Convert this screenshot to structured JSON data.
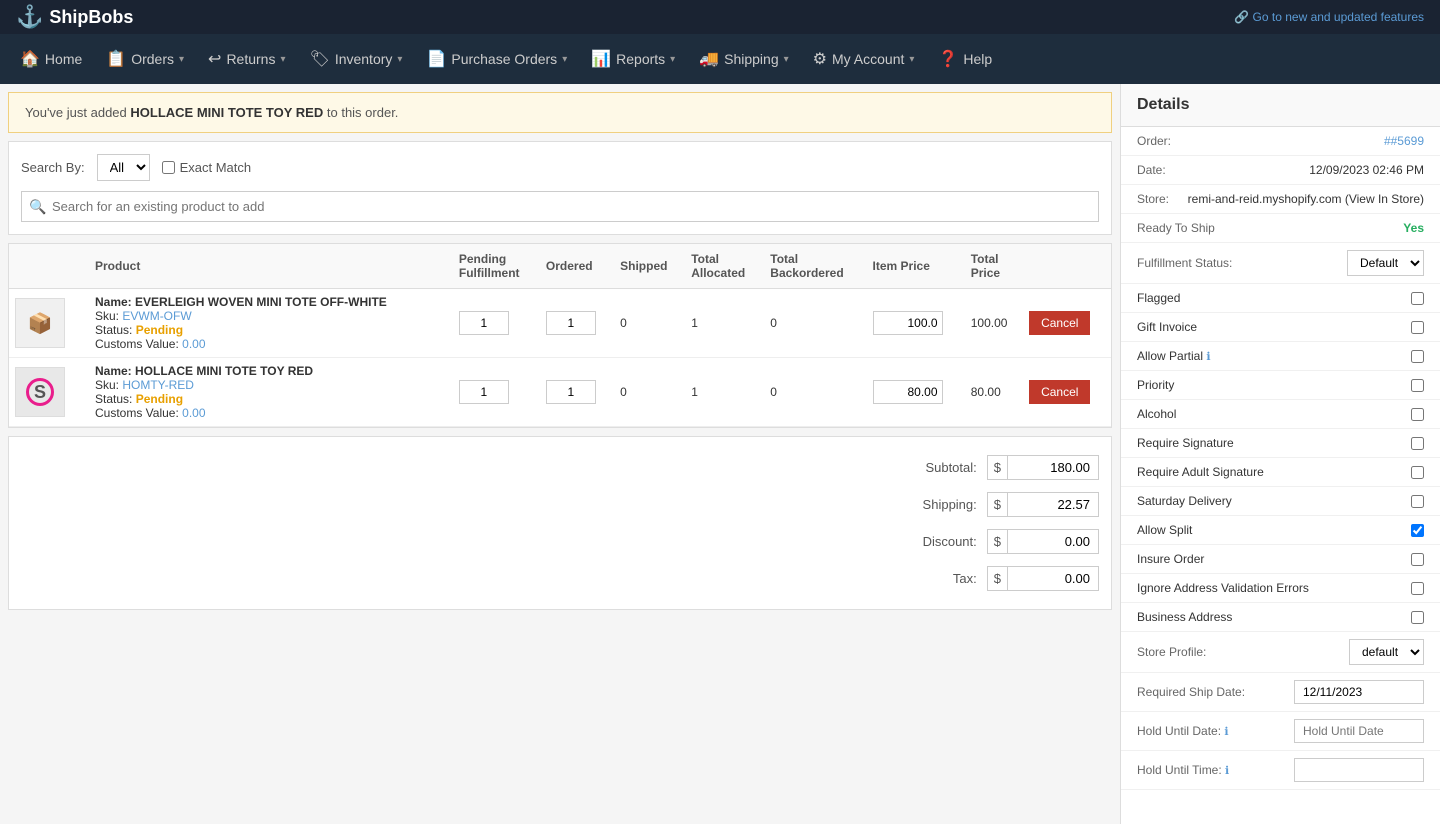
{
  "topBanner": {
    "logoText": "ShipBobs",
    "newFeaturesText": "Go to new and updated features"
  },
  "nav": {
    "items": [
      {
        "label": "Home",
        "icon": "🏠"
      },
      {
        "label": "Orders",
        "icon": "📋",
        "hasDropdown": true
      },
      {
        "label": "Returns",
        "icon": "↩",
        "hasDropdown": true
      },
      {
        "label": "Inventory",
        "icon": "🏷",
        "hasDropdown": true
      },
      {
        "label": "Purchase Orders",
        "icon": "📄",
        "hasDropdown": true
      },
      {
        "label": "Reports",
        "icon": "📊",
        "hasDropdown": true
      },
      {
        "label": "Shipping",
        "icon": "🚚",
        "hasDropdown": true
      },
      {
        "label": "My Account",
        "icon": "⚙",
        "hasDropdown": true
      },
      {
        "label": "Help",
        "icon": "❓"
      }
    ]
  },
  "alert": {
    "prefix": "You've just added",
    "productName": "HOLLACE MINI TOTE TOY RED",
    "suffix": "to this order."
  },
  "searchArea": {
    "searchByLabel": "Search By:",
    "searchByDefault": "All",
    "exactMatchLabel": "Exact Match",
    "searchPlaceholder": "Search for an existing product to add"
  },
  "table": {
    "columns": [
      "Product",
      "Pending Fulfillment",
      "Ordered",
      "Shipped",
      "Total Allocated",
      "Total Backordered",
      "Item Price",
      "Total Price"
    ],
    "rows": [
      {
        "id": "row1",
        "imgIcon": "📦",
        "name": "Name: EVERLEIGH WOVEN MINI TOTE OFF-WHITE",
        "nameLabel": "EVERLEIGH WOVEN MINI TOTE OFF-WHITE",
        "skuLabel": "Sku:",
        "sku": "EVWM-OFW",
        "statusLabel": "Status:",
        "status": "Pending",
        "customsLabel": "Customs Value:",
        "customsValue": "0.00",
        "pendingFulfillment": "1",
        "ordered": "1",
        "shipped": "0",
        "totalAllocated": "1",
        "totalBackordered": "0",
        "itemPrice": "100.0",
        "totalPrice": "100.00",
        "cancelLabel": "Cancel"
      },
      {
        "id": "row2",
        "imgIcon": "S",
        "name": "Name: HOLLACE MINI TOTE TOY RED",
        "nameLabel": "HOLLACE MINI TOTE TOY RED",
        "skuLabel": "Sku:",
        "sku": "HOMTY-RED",
        "statusLabel": "Status:",
        "status": "Pending",
        "customsLabel": "Customs Value:",
        "customsValue": "0.00",
        "pendingFulfillment": "1",
        "ordered": "1",
        "shipped": "0",
        "totalAllocated": "1",
        "totalBackordered": "0",
        "itemPrice": "80.00",
        "totalPrice": "80.00",
        "cancelLabel": "Cancel"
      }
    ]
  },
  "totals": {
    "subtotalLabel": "Subtotal:",
    "subtotalValue": "180.00",
    "shippingLabel": "Shipping:",
    "shippingValue": "22.57",
    "discountLabel": "Discount:",
    "discountValue": "0.00",
    "taxLabel": "Tax:",
    "taxValue": "0.00",
    "dollarSign": "$"
  },
  "details": {
    "title": "Details",
    "orderLabel": "Order:",
    "orderValue": "##5699",
    "dateLabel": "Date:",
    "dateValue": "12/09/2023 02:46 PM",
    "storeLabel": "Store:",
    "storeValue": "remi-and-reid.myshopify.com",
    "storeLink": "View In Store",
    "readyToShipLabel": "Ready To Ship",
    "readyToShipValue": "Yes",
    "fulfillmentStatusLabel": "Fulfillment Status:",
    "fulfillmentDefault": "Default",
    "flaggedLabel": "Flagged",
    "giftInvoiceLabel": "Gift Invoice",
    "allowPartialLabel": "Allow Partial",
    "priorityLabel": "Priority",
    "alcoholLabel": "Alcohol",
    "requireSignatureLabel": "Require Signature",
    "requireAdultSignatureLabel": "Require Adult Signature",
    "saturdayDeliveryLabel": "Saturday Delivery",
    "allowSplitLabel": "Allow Split",
    "allowSplitChecked": true,
    "insureOrderLabel": "Insure Order",
    "ignoreAddressValidationErrorsLabel": "Ignore Address Validation Errors",
    "businessAddressLabel": "Business Address",
    "storeProfileLabel": "Store Profile:",
    "storeProfileDefault": "default",
    "requiredShipDateLabel": "Required Ship Date:",
    "requiredShipDateValue": "12/11/2023",
    "holdUntilDateLabel": "Hold Until Date:",
    "holdUntilDatePlaceholder": "Hold Until Date",
    "holdUntilTimeLabel": "Hold Until Time:"
  }
}
